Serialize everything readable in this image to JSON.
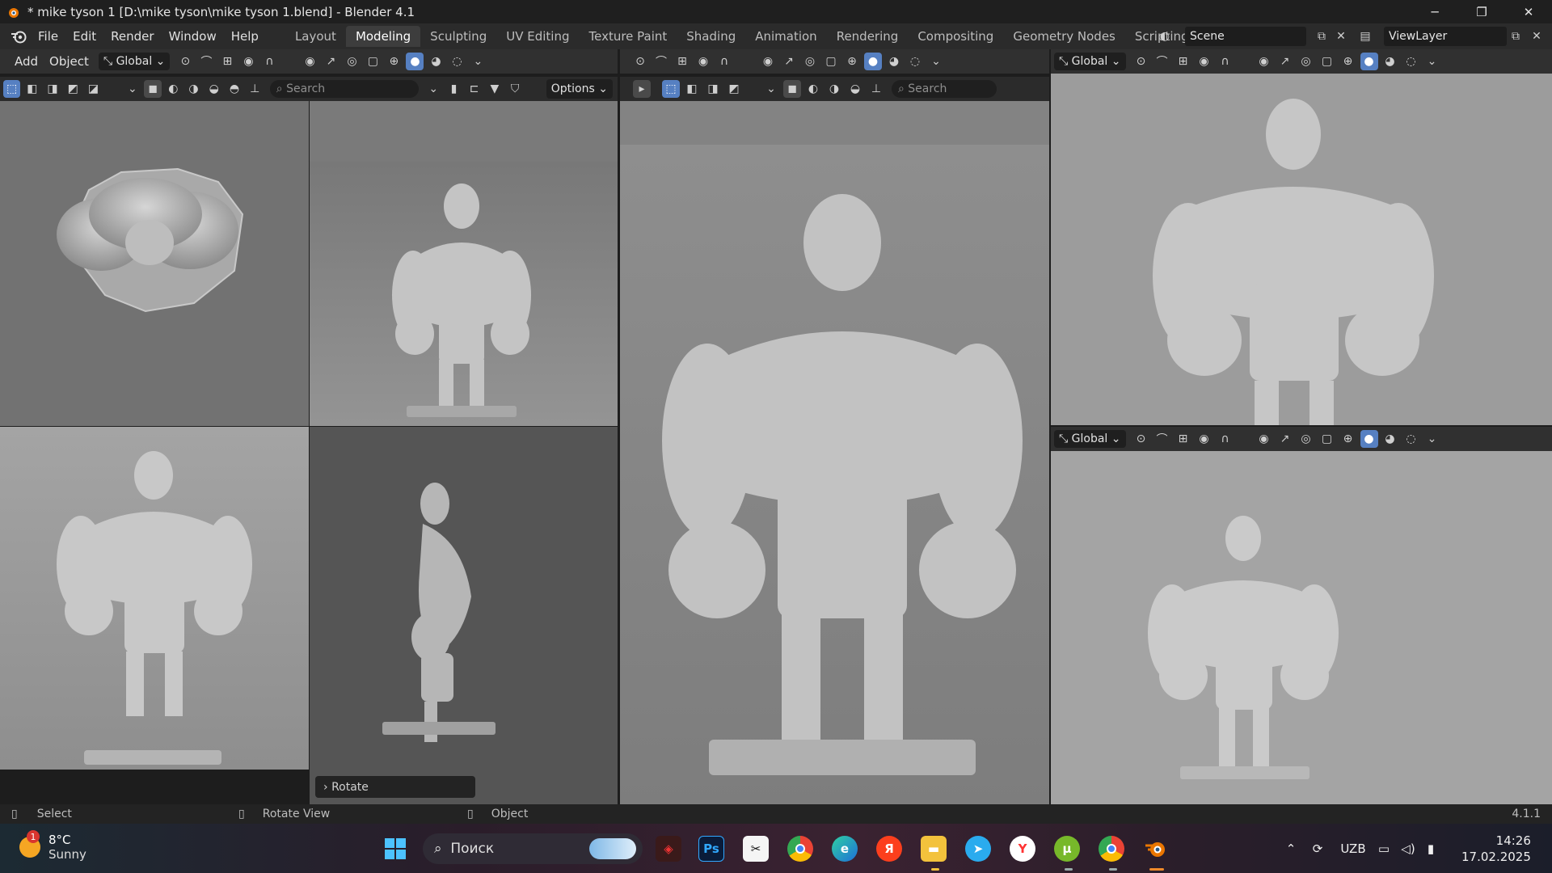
{
  "window": {
    "title": "* mike tyson 1 [D:\\mike tyson\\mike tyson 1.blend] - Blender 4.1",
    "minimize": "─",
    "restore": "❐",
    "close": "✕"
  },
  "menu": [
    "File",
    "Edit",
    "Render",
    "Window",
    "Help"
  ],
  "workspaces": [
    {
      "label": "Layout",
      "active": false
    },
    {
      "label": "Modeling",
      "active": true
    },
    {
      "label": "Sculpting",
      "active": false
    },
    {
      "label": "UV Editing",
      "active": false
    },
    {
      "label": "Texture Paint",
      "active": false
    },
    {
      "label": "Shading",
      "active": false
    },
    {
      "label": "Animation",
      "active": false
    },
    {
      "label": "Rendering",
      "active": false
    },
    {
      "label": "Compositing",
      "active": false
    },
    {
      "label": "Geometry Nodes",
      "active": false
    },
    {
      "label": "Scripting",
      "active": false
    }
  ],
  "add_workspace": "+",
  "scene_name": "Scene",
  "view_layer": "ViewLayer",
  "left_header": {
    "add": "Add",
    "object": "Object",
    "orientation": "Global",
    "search_placeholder": "Search",
    "options": "Options"
  },
  "center_header": {
    "search_placeholder": "Search"
  },
  "right_top_header": {
    "orientation": "Global"
  },
  "right_bottom_header": {
    "orientation": "Global"
  },
  "last_operator": "Rotate",
  "status": {
    "left": "Select",
    "middle": "Rotate View",
    "right": "Object",
    "version": "4.1.1"
  },
  "taskbar": {
    "weather_temp": "8°C",
    "weather_desc": "Sunny",
    "weather_badge": "1",
    "search_placeholder": "Поиск",
    "language": "UZB",
    "time": "14:26",
    "date": "17.02.2025",
    "apps": [
      "windows-start",
      "game-app",
      "photoshop",
      "capcut",
      "chrome",
      "edge",
      "yandex",
      "file-explorer",
      "telegram",
      "yandex-browser",
      "utorrent",
      "chrome-profile",
      "blender"
    ]
  },
  "colors": {
    "accent": "#5680c2",
    "header_bg": "#303030",
    "viewport_bg": "#4a4a4a",
    "active_tab": "#3d3d3d"
  }
}
